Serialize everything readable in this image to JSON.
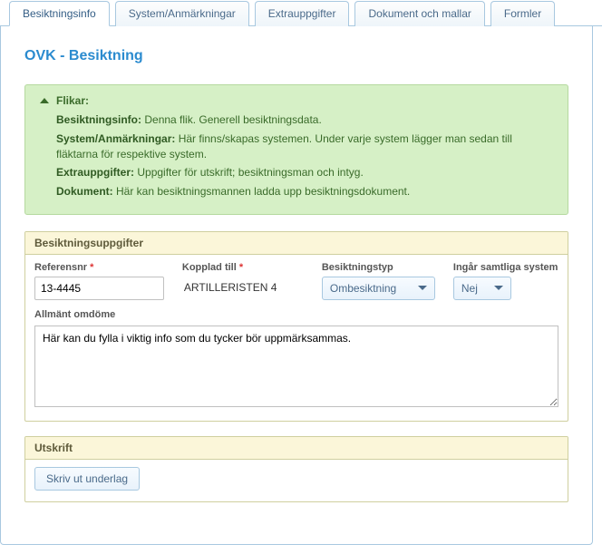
{
  "tabs": [
    {
      "label": "Besiktningsinfo",
      "active": true
    },
    {
      "label": "System/Anmärkningar",
      "active": false
    },
    {
      "label": "Extrauppgifter",
      "active": false
    },
    {
      "label": "Dokument och mallar",
      "active": false
    },
    {
      "label": "Formler",
      "active": false
    }
  ],
  "page_title": "OVK - Besiktning",
  "info": {
    "heading": "Flikar:",
    "lines": [
      {
        "label": "Besiktningsinfo:",
        "text": " Denna flik. Generell besiktningsdata."
      },
      {
        "label": "System/Anmärkningar:",
        "text": " Här finns/skapas systemen. Under varje system lägger man sedan till fläktarna för respektive system."
      },
      {
        "label": "Extrauppgifter:",
        "text": " Uppgifter för utskrift; besiktningsman och intyg."
      },
      {
        "label": "Dokument:",
        "text": " Här kan besiktningsmannen ladda upp besiktningsdokument."
      }
    ]
  },
  "section_uppgifter": {
    "title": "Besiktningsuppgifter",
    "referensnr_label": "Referensnr",
    "referensnr_value": "13-4445",
    "kopplad_label": "Kopplad till",
    "kopplad_value": "ARTILLERISTEN 4",
    "typ_label": "Besiktningstyp",
    "typ_value": "Ombesiktning",
    "ingar_label": "Ingår samtliga system",
    "ingar_value": "Nej",
    "allmant_label": "Allmänt omdöme",
    "allmant_value": "Här kan du fylla i viktig info som du tycker bör uppmärksammas."
  },
  "section_utskrift": {
    "title": "Utskrift",
    "button": "Skriv ut underlag"
  }
}
